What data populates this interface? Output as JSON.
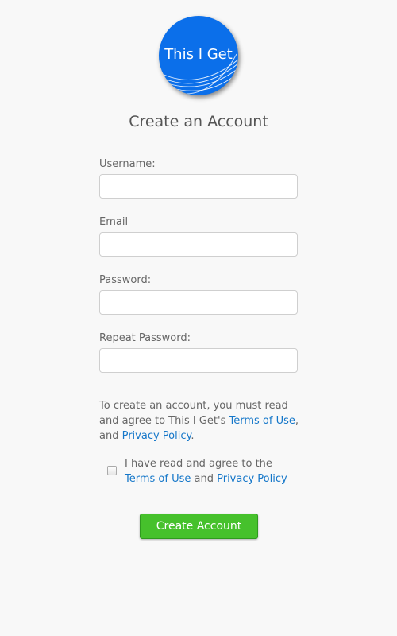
{
  "logo": {
    "text": "This I Get",
    "color": "#0b6fea"
  },
  "page": {
    "title": "Create an Account"
  },
  "form": {
    "username_label": "Username:",
    "email_label": "Email",
    "password_label": "Password:",
    "repeat_password_label": "Repeat Password:",
    "username_value": "",
    "email_value": "",
    "password_value": "",
    "repeat_password_value": ""
  },
  "notice": {
    "text_before": "To create an account, you must read and agree to This I Get's ",
    "terms_link": "Terms of Use",
    "text_middle": ", and ",
    "privacy_link": "Privacy Policy",
    "text_after": "."
  },
  "agreement": {
    "checked": false,
    "text_before": "I have read and agree to the ",
    "terms_link": "Terms of Use",
    "text_middle": " and ",
    "privacy_link": "Privacy Policy"
  },
  "submit": {
    "label": "Create Account",
    "color": "#46c12c"
  },
  "colors": {
    "link": "#1577c9",
    "background": "#f8f8f8"
  }
}
